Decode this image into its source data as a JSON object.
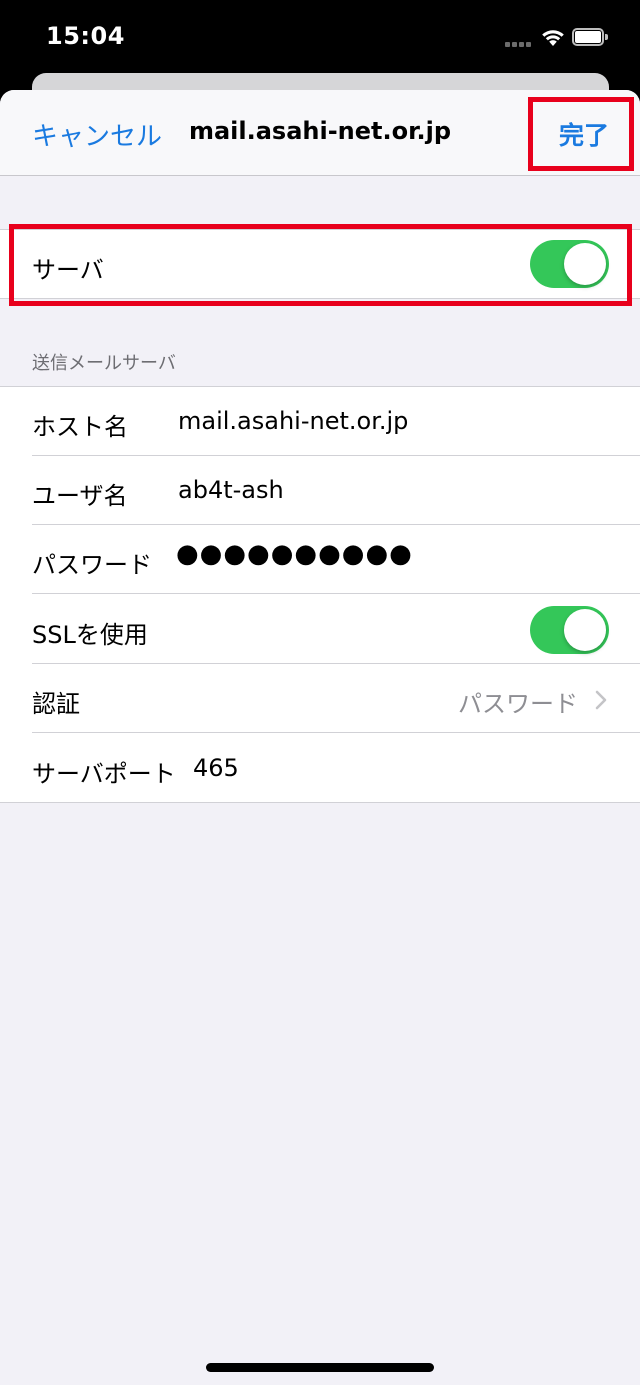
{
  "status_bar": {
    "time": "15:04"
  },
  "nav": {
    "cancel_label": "キャンセル",
    "title": "mail.asahi-net.or.jp",
    "done_label": "完了"
  },
  "server_group": {
    "label": "サーバ",
    "toggle_on": true
  },
  "smtp_section": {
    "header": "送信メールサーバ",
    "rows": {
      "host": {
        "label": "ホスト名",
        "value": "mail.asahi-net.or.jp"
      },
      "username": {
        "label": "ユーザ名",
        "value": "ab4t-ash"
      },
      "password": {
        "label": "パスワード",
        "value": "●●●●●●●●●●"
      },
      "ssl": {
        "label": "SSLを使用",
        "toggle_on": true
      },
      "auth": {
        "label": "認証",
        "value": "パスワード"
      },
      "port": {
        "label": "サーバポート",
        "value": "465"
      }
    }
  },
  "colors": {
    "accent_blue": "#1a7ae0",
    "toggle_green": "#34c759",
    "highlight_red": "#e8001c",
    "background": "#f2f1f7"
  },
  "icons": [
    "signal-icon",
    "wifi-icon",
    "battery-icon",
    "chevron-right-icon"
  ]
}
